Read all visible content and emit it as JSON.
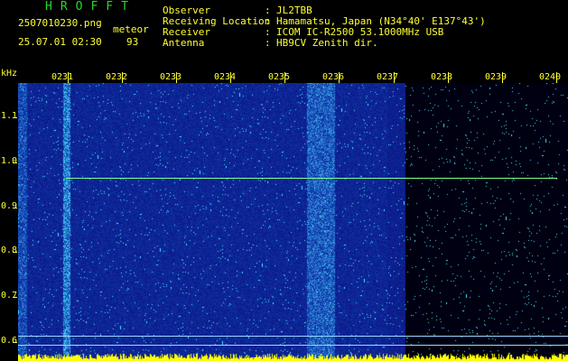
{
  "header": {
    "logo_text": "HROFFT",
    "filename": "2507010230.png",
    "mode_label": "meteor",
    "datetime": "25.07.01 02:30",
    "count": "93",
    "fields": [
      {
        "label": "Observer",
        "sep": ":",
        "value": "JL2TBB"
      },
      {
        "label": "Receiving Location",
        "sep": ":",
        "value": "Hamamatsu, Japan (N34°40' E137°43')"
      },
      {
        "label": "Receiver",
        "sep": ":",
        "value": "ICOM IC-R2500 53.1000MHz USB"
      },
      {
        "label": "Antenna",
        "sep": ":",
        "value": "HB9CV Zenith dir."
      }
    ]
  },
  "chart_data": {
    "type": "heatmap",
    "title": "",
    "ylabel": "kHz",
    "y_ticks": [
      "1.1",
      "1.0",
      "0.9",
      "0.8",
      "0.7",
      "0.6"
    ],
    "x_ticks": [
      "0231",
      "0232",
      "0233",
      "0234",
      "0235",
      "0236",
      "0237",
      "0238",
      "0239",
      "0240"
    ],
    "y_range_khz": [
      0.57,
      1.17
    ],
    "x_range_minutes": [
      "02:30",
      "02:40"
    ],
    "carrier_freq_khz": 0.965,
    "ref_lines_khz": [
      0.615,
      0.595
    ],
    "colors": {
      "background": "#000000",
      "noise_low": "#0a1a8a",
      "noise_high": "#40d0ff",
      "carrier": "#7cff8c",
      "ref_line": "#9ad7ff",
      "labels": "#ffff33",
      "logo": "#22dd22"
    }
  }
}
